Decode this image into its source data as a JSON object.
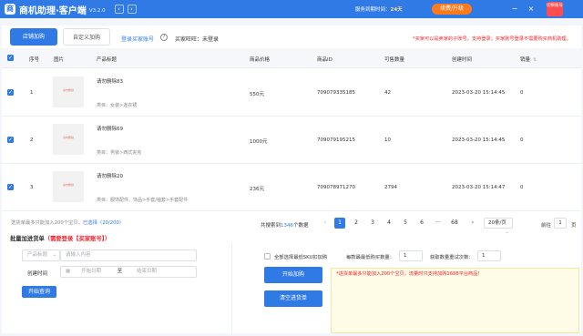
{
  "app": {
    "title": "商机助理·客户端",
    "version": "V3.2.0",
    "expire_label": "服务到期时间：",
    "expire_days": "24天",
    "renew_button": "续费/升级",
    "account_label": "切换账号",
    "icons": {
      "back": "chevron-left-icon",
      "forward": "chevron-right-icon",
      "minimize": "minimize-icon",
      "close": "close-icon"
    }
  },
  "tabs": [
    {
      "label": "店铺加购",
      "active": true
    },
    {
      "label": "自定义加购",
      "active": false
    }
  ],
  "login_link": "登录买家账号",
  "wangwang": "买家旺旺：未登录",
  "top_notice": "*买家可以是卖家的子账号，支持登录；买家账号登录不需要购买商机助理。",
  "table": {
    "headers": [
      "序号",
      "图片",
      "产品标题",
      "商品价格",
      "商品ID",
      "可售数量",
      "创建时间",
      "销量"
    ],
    "rows": [
      {
        "index": "1",
        "thumb_text": "请勿删除",
        "title": "请勿删除83",
        "category": "类目：女装>连衣裙",
        "price": "550元",
        "id": "709079335185",
        "stock": "42",
        "created": "2023-03-20 15:14:45",
        "sales": "0"
      },
      {
        "index": "2",
        "thumb_text": "请勿删除",
        "title": "请勿删除69",
        "category": "类目：男装>西式夹克",
        "price": "1000元",
        "id": "709079195215",
        "stock": "10",
        "created": "2023-03-20 15:14:45",
        "sales": "0"
      },
      {
        "index": "3",
        "thumb_text": "请勿删除",
        "title": "请勿删除20",
        "category": "类目：服饰配件、饰品>手套/袖套>手套配件",
        "price": "236元",
        "id": "709078971270",
        "stock": "2794",
        "created": "2023-03-20 15:14:47",
        "sales": "0"
      }
    ]
  },
  "pager": {
    "info_prefix": "选货单最多只能加入200个宝贝，",
    "info_selected": "已选择",
    "info_count": "（20/200）",
    "total_prefix": "共搜索到",
    "total_count": "1346",
    "total_suffix": "个数据",
    "pages": [
      "1",
      "2",
      "3",
      "4",
      "5",
      "6",
      "···",
      "68"
    ],
    "prev": "‹",
    "next": "›",
    "per_page": "20条/页",
    "goto_label": "前往",
    "goto_value": "1",
    "goto_unit": "页"
  },
  "batch": {
    "title": "批量加进货单",
    "title_warn": "（需要登录【买家账号】）",
    "title_select": "产品标题",
    "title_placeholder": "请输入内容",
    "created_label": "创建时间",
    "start_placeholder": "开始日期",
    "range_sep": "至",
    "end_placeholder": "结束日期",
    "search_button": "开始查询",
    "select_all": "全部选择最低SKU扣加购",
    "min_buy_label": "每款最最低购买数量：",
    "min_buy_value": "1",
    "fetch_label": "获取数量重试次数：",
    "fetch_value": "1",
    "start_add_button": "开始加购",
    "clear_button": "清空进货单",
    "warning": "*进货单最多只能加入200个宝贝，流量时只支持加购1688平台商品！"
  }
}
